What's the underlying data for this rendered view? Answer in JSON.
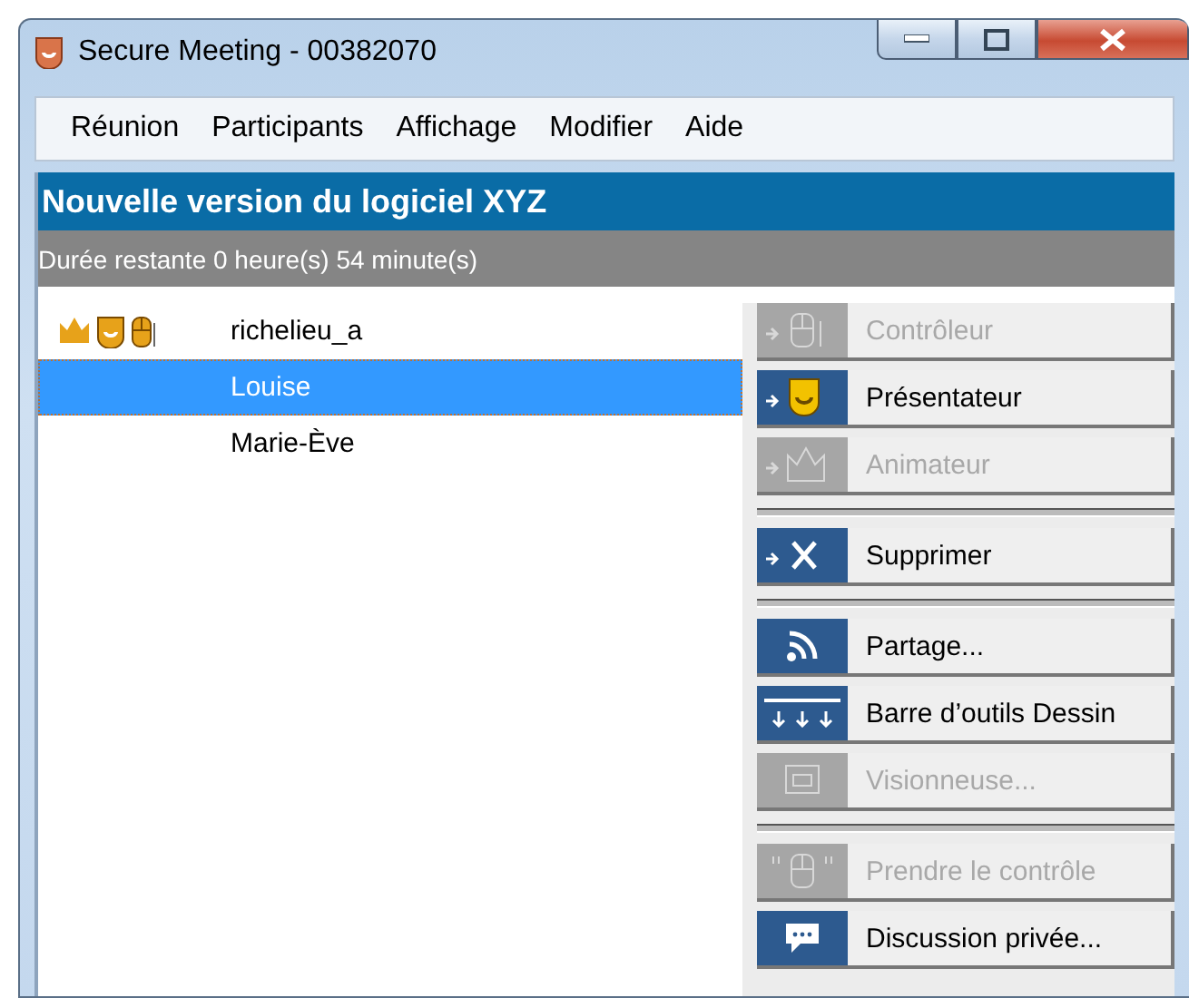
{
  "window": {
    "title": "Secure Meeting - 00382070"
  },
  "menu": [
    "Réunion",
    "Participants",
    "Affichage",
    "Modifier",
    "Aide"
  ],
  "banner": "Nouvelle version du logiciel XYZ",
  "status": "Durée restante 0 heure(s) 54 minute(s)",
  "participants": [
    {
      "name": "richelieu_a",
      "selected": false
    },
    {
      "name": "Louise",
      "selected": true
    },
    {
      "name": "Marie-Ève",
      "selected": false
    }
  ],
  "actions": [
    [
      {
        "label": "Contrôleur",
        "disabled": true
      },
      {
        "label": "Présentateur",
        "disabled": false
      },
      {
        "label": "Animateur",
        "disabled": true
      }
    ],
    [
      {
        "label": "Supprimer",
        "disabled": false
      }
    ],
    [
      {
        "label": "Partage...",
        "disabled": false
      },
      {
        "label": "Barre d’outils Dessin",
        "disabled": false
      },
      {
        "label": "Visionneuse...",
        "disabled": true
      }
    ],
    [
      {
        "label": "Prendre le contrôle",
        "disabled": true
      },
      {
        "label": "Discussion privée...",
        "disabled": false
      }
    ]
  ]
}
